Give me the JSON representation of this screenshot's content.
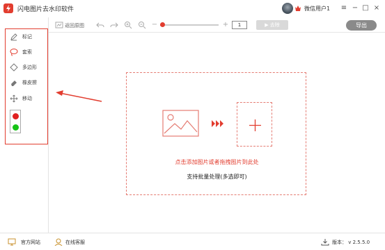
{
  "app": {
    "title": "闪电图片去水印软件",
    "user_name": "微信用户1",
    "brand_color": "#e23d2f"
  },
  "window_controls": {
    "menu": "≡",
    "minimize": "−",
    "maximize": "□",
    "close": "×"
  },
  "toolbar": {
    "back_label": "返回原图",
    "undo_icon": "undo-icon",
    "redo_icon": "redo-icon",
    "zoom_in_icon": "zoom-in-icon",
    "zoom_out_icon": "zoom-out-icon",
    "zoom_minus": "−",
    "zoom_plus": "+",
    "zoom_level": 0.04,
    "page_value": "1",
    "remove_label": "▶ 去除",
    "export_label": "导出"
  },
  "tools": [
    {
      "label": "标记",
      "icon": "pen-icon"
    },
    {
      "label": "套索",
      "icon": "lasso-icon"
    },
    {
      "label": "多边形",
      "icon": "polygon-icon"
    },
    {
      "label": "橡皮擦",
      "icon": "eraser-icon"
    },
    {
      "label": "移动",
      "icon": "move-icon"
    }
  ],
  "colors": {
    "red": "#e02020",
    "green": "#16c316"
  },
  "drop_zone": {
    "prompt": "点击添加图片或者拖拽图片到此处",
    "subtext": "支持批量处理(多选即可)"
  },
  "statusbar": {
    "website_label": "官方网站",
    "service_label": "在线客服",
    "version_label": "版本： v 2.5.5.0"
  }
}
